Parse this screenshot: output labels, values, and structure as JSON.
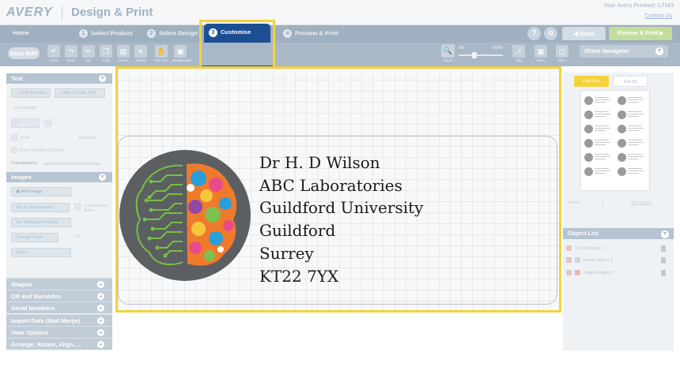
{
  "header": {
    "logo": "AVERY",
    "title": "Design & Print",
    "product_label": "Your Avery Product: L7163",
    "contact_link": "Contact Us"
  },
  "steps": [
    {
      "label": "Home"
    },
    {
      "num": "1",
      "label": "Select Product"
    },
    {
      "num": "2",
      "label": "Select Design"
    },
    {
      "num": "3",
      "label": "Customise"
    },
    {
      "num": "4",
      "label": "Preview & Print"
    }
  ],
  "nav": {
    "help": "?",
    "back": "Back",
    "preview_print": "Preview & Print"
  },
  "toolbar": {
    "easy_edit": "Easy Edit",
    "tools": [
      "Undo",
      "Redo",
      "Cut",
      "Copy",
      "Paste",
      "Delete",
      "Pan Tool",
      "Background"
    ],
    "right_tools": [
      "Clip",
      "Save",
      "Open"
    ],
    "zoom": {
      "label": "Zoom",
      "min": "0%",
      "max": "400%"
    }
  },
  "left_panel": {
    "text_section": {
      "title": "Text",
      "add_text_box": "Add Text Box",
      "add_circular_text": "Add Circular Text",
      "format_title": "Format title",
      "font_size": "12",
      "bold_label": "Bold",
      "numbers_label": "Numbers",
      "show_outlines": "Show Text Box Outlines",
      "transparency": "Transparency"
    },
    "images_section": {
      "title": "Images",
      "add_image": "Add Image",
      "set_background": "Set as Background",
      "lock_aspect": "Lock Aspect Ratio",
      "set_transparent": "Set Transparent Color",
      "change_color": "Change Color",
      "fill": "Fill",
      "crop": "Crop"
    },
    "accordion": [
      "Shapes",
      "QR and Barcodes",
      "Serial Numbers",
      "Import Data (Mail Merge)",
      "View Options",
      "Arrange, Rotate, Align, ..."
    ]
  },
  "canvas": {
    "address_lines": [
      "Dr H. D Wilson",
      "ABC Laboratories",
      "Guildford University",
      "Guildford",
      "Surrey",
      "KT22 7YX"
    ]
  },
  "right_panel": {
    "sheet_navigator": "Sheet Navigator",
    "tab_edit_one": "Edit One",
    "tab_edit_all": "Edit All",
    "sheet_label": "Sheet",
    "sheet_number": "1",
    "add_sheet": "Add Sheet",
    "object_list": {
      "title": "Object List",
      "items": [
        {
          "num": "1",
          "label": "Text Object 1"
        },
        {
          "num": "",
          "label": "Image Object 2"
        },
        {
          "num": "",
          "label": "Shape Object 1"
        }
      ]
    }
  },
  "colors": {
    "highlight": "#f4d23c",
    "active_tab": "#1c4e93",
    "step_bar": "#9fb0c0",
    "panel_header": "#b6c3d1",
    "brain_bg": "#5b5f62",
    "circuit": "#78c043"
  },
  "icons": [
    "undo-icon",
    "redo-icon",
    "cut-icon",
    "copy-icon",
    "paste-icon",
    "delete-icon",
    "hand-icon",
    "background-icon",
    "zoom-icon",
    "clip-icon",
    "save-icon",
    "open-icon",
    "chevron-down-icon",
    "plus-icon",
    "trash-icon",
    "help-icon",
    "settings-icon"
  ]
}
